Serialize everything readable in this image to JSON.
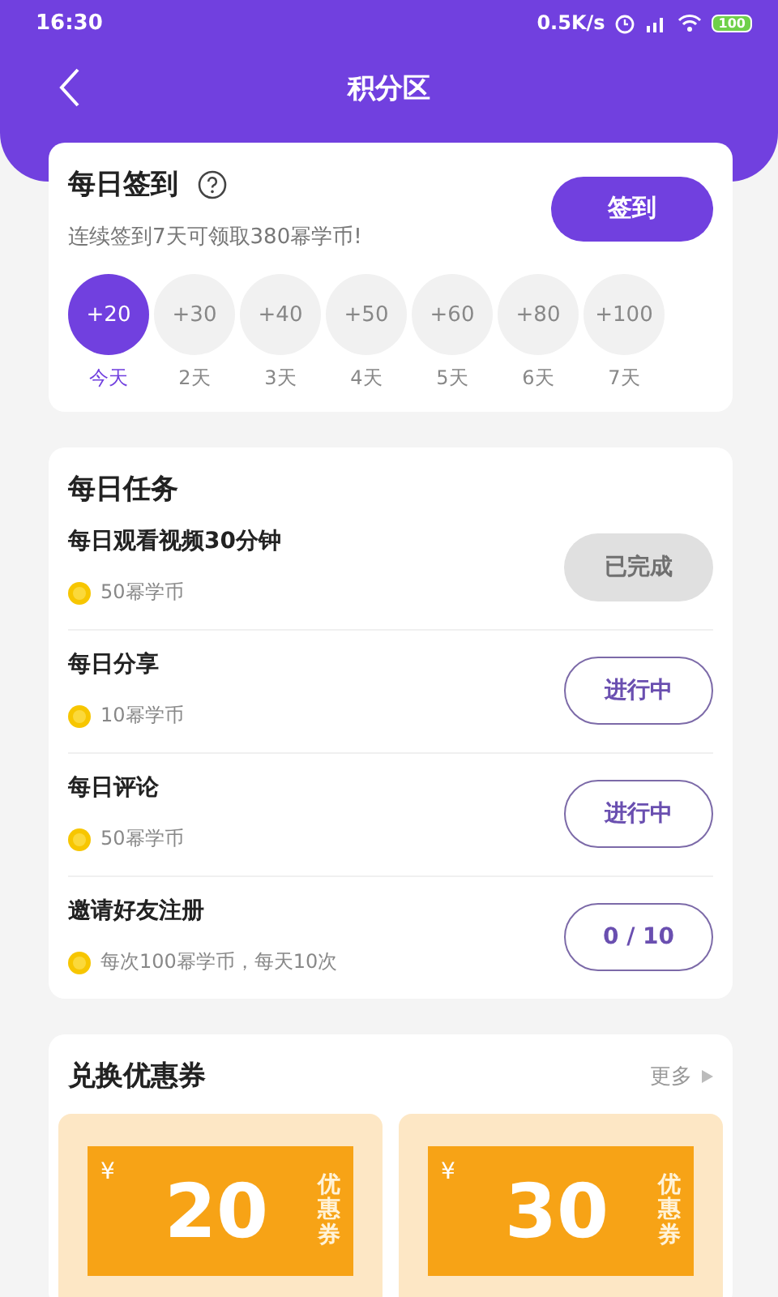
{
  "status_bar": {
    "time": "16:30",
    "net_speed": "0.5K/s",
    "battery": "100"
  },
  "nav": {
    "title": "积分区"
  },
  "checkin": {
    "title": "每日签到",
    "subtitle": "连续签到7天可领取380幂学币!",
    "button": "签到",
    "days": [
      {
        "amount": "+20",
        "label": "今天",
        "selected": true
      },
      {
        "amount": "+30",
        "label": "2天",
        "selected": false
      },
      {
        "amount": "+40",
        "label": "3天",
        "selected": false
      },
      {
        "amount": "+50",
        "label": "4天",
        "selected": false
      },
      {
        "amount": "+60",
        "label": "5天",
        "selected": false
      },
      {
        "amount": "+80",
        "label": "6天",
        "selected": false
      },
      {
        "amount": "+100",
        "label": "7天",
        "selected": false
      }
    ]
  },
  "tasks": {
    "title": "每日任务",
    "items": [
      {
        "name": "每日观看视频30分钟",
        "reward": "50幂学币",
        "action": "已完成",
        "kind": "done"
      },
      {
        "name": "每日分享",
        "reward": "10幂学币",
        "action": "进行中",
        "kind": "progress"
      },
      {
        "name": "每日评论",
        "reward": "50幂学币",
        "action": "进行中",
        "kind": "progress"
      },
      {
        "name": "邀请好友注册",
        "reward": "每次100幂学币，每天10次",
        "action": "0 / 10",
        "kind": "count"
      }
    ]
  },
  "coupons": {
    "title": "兑换优惠券",
    "more": "更多",
    "items": [
      {
        "currency": "¥",
        "amount": "20",
        "tag": "优惠券"
      },
      {
        "currency": "¥",
        "amount": "30",
        "tag": "优惠券"
      }
    ]
  }
}
